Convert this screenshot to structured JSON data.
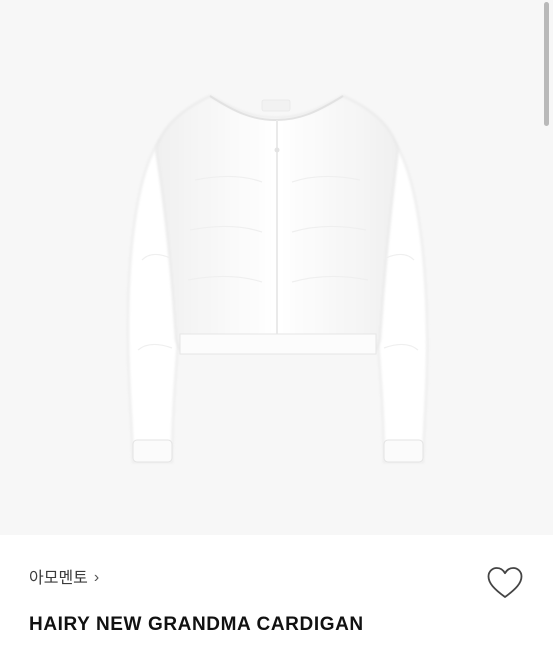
{
  "product": {
    "brand": "아모멘토",
    "brand_chevron": "›",
    "name": "HAIRY NEW GRANDMA CARDIGAN",
    "image_alt": "white-cardigan"
  },
  "icons": {
    "like": "heart-outline-icon",
    "brand_arrow": "chevron-right-icon"
  },
  "colors": {
    "image_background": "#f7f7f7",
    "garment": "#ffffff",
    "text_primary": "#111111",
    "text_secondary": "#3b3b3b"
  }
}
